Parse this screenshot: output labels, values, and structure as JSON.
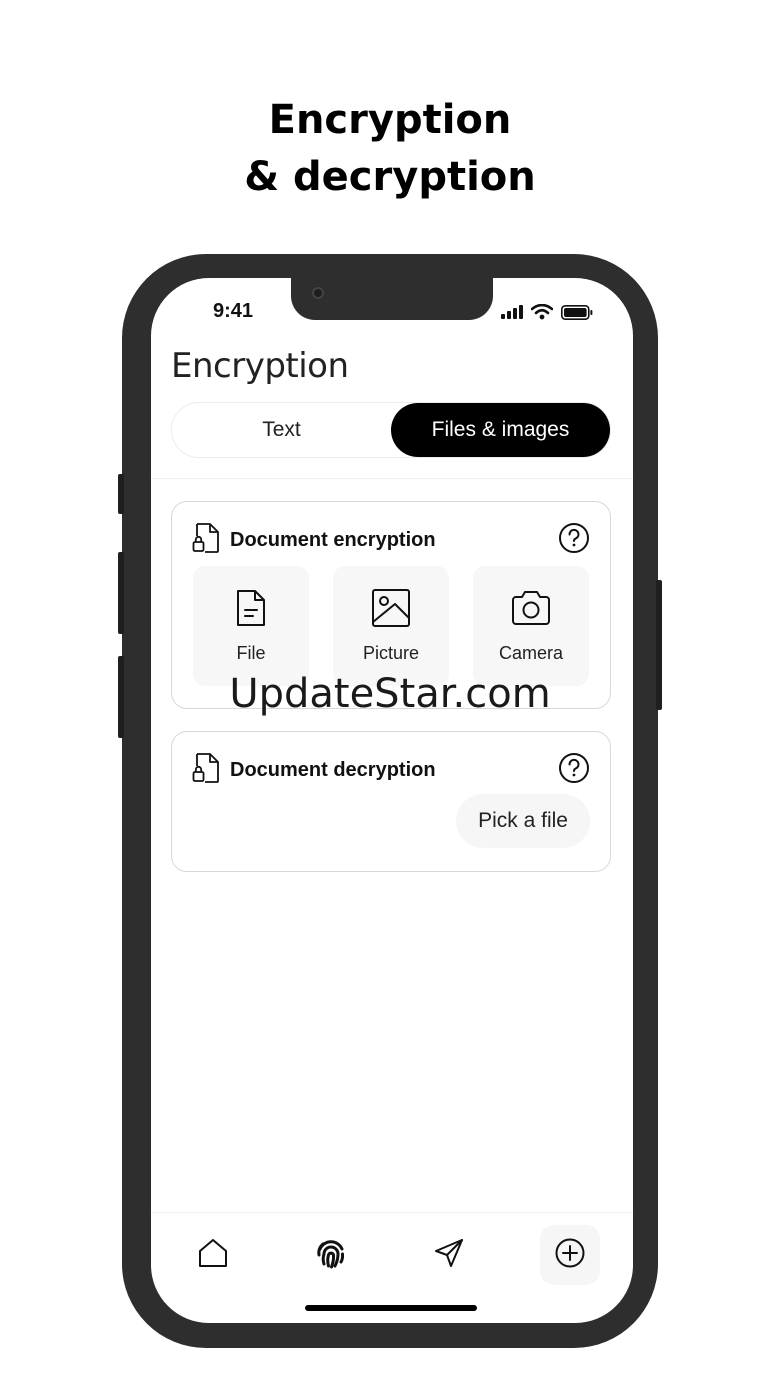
{
  "headline": {
    "line1": "Encryption",
    "line2": "& decryption"
  },
  "status_bar": {
    "time": "9:41",
    "icons": [
      "cellular-signal-icon",
      "wifi-icon",
      "battery-icon"
    ]
  },
  "screen": {
    "title": "Encryption",
    "tabs": [
      {
        "label": "Text",
        "active": false
      },
      {
        "label": "Files & images",
        "active": true
      }
    ]
  },
  "encrypt_card": {
    "title": "Document encryption",
    "icon": "locked-document-icon",
    "help_icon": "help-icon",
    "options": [
      {
        "label": "File",
        "icon": "file-icon"
      },
      {
        "label": "Picture",
        "icon": "image-icon"
      },
      {
        "label": "Camera",
        "icon": "camera-icon"
      }
    ]
  },
  "decrypt_card": {
    "title": "Document decryption",
    "icon": "locked-document-icon",
    "help_icon": "help-icon",
    "pick_label": "Pick a file"
  },
  "watermark": "UpdateStar.com",
  "bottom_nav": [
    {
      "icon": "home-icon",
      "active": false
    },
    {
      "icon": "fingerprint-icon",
      "active": true
    },
    {
      "icon": "send-icon",
      "active": false
    },
    {
      "icon": "add-circle-icon",
      "active": false
    }
  ],
  "colors": {
    "accent": "#000000",
    "card_border": "#d8d8d8",
    "tile_bg": "#f7f7f7",
    "phone_frame": "#2e2e2e"
  }
}
